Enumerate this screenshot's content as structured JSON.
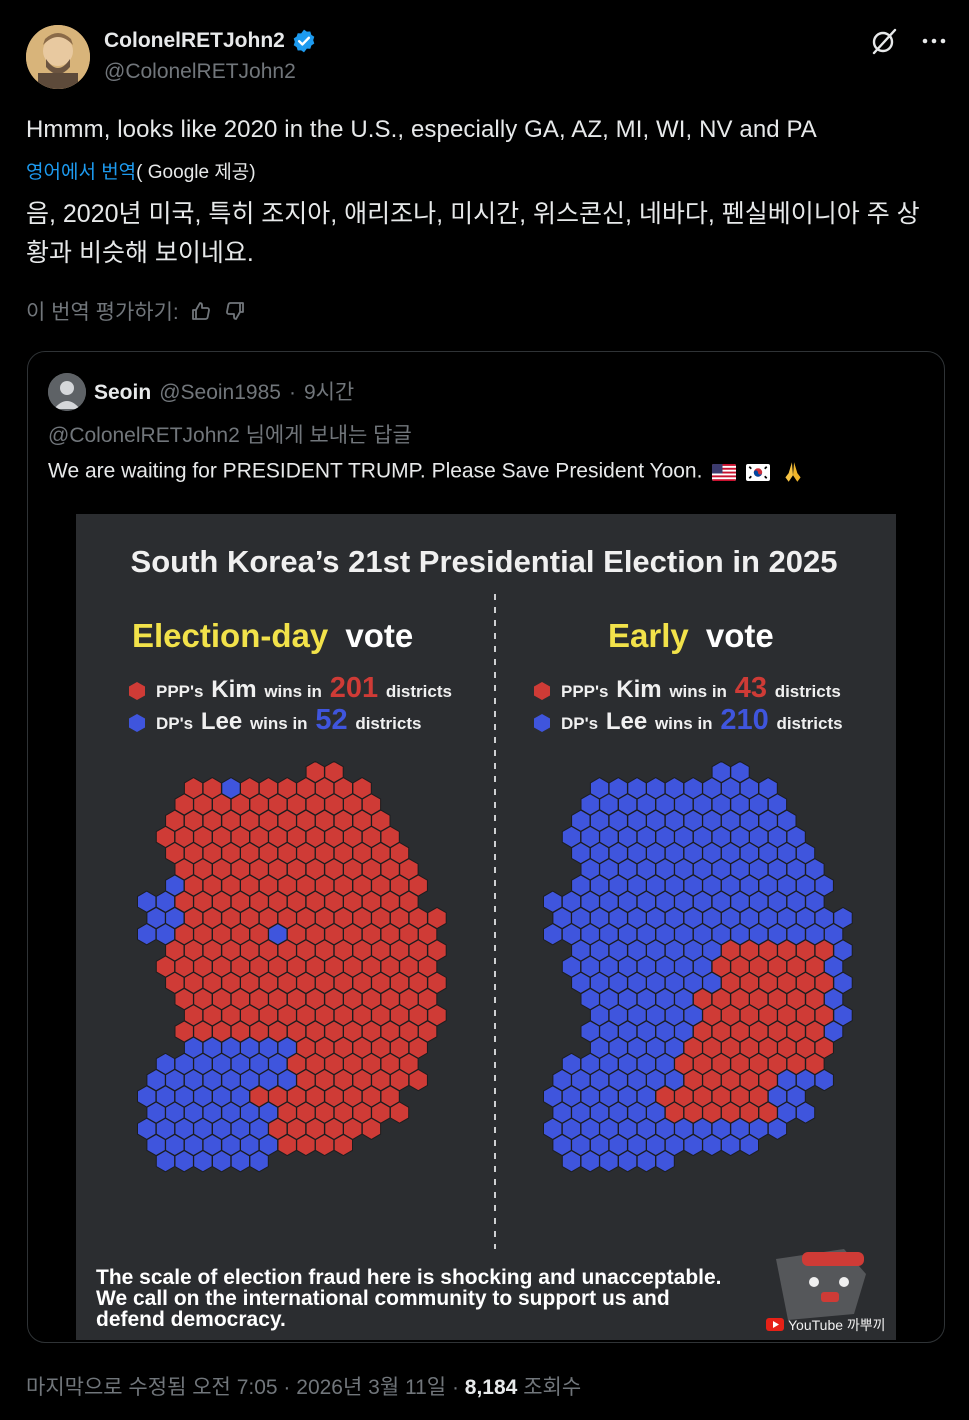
{
  "author": {
    "name": "ColonelRETJohn2",
    "handle": "@ColonelRETJohn2"
  },
  "icons": [
    "verified-badge-icon",
    "grok-slash-icon",
    "more-icon",
    "thumbs-up-icon",
    "thumbs-down-icon"
  ],
  "post": {
    "text": "Hmmm, looks like 2020 in the U.S., especially GA, AZ, MI, WI, NV and PA",
    "translate_link": "영어에서 번역",
    "translate_provider": "( Google 제공)",
    "translated_text": "음, 2020년 미국, 특히 조지아, 애리조나, 미시간, 위스콘신, 네바다, 펜실베이니아 주 상황과 비슷해 보이네요.",
    "rate_label": "이 번역 평가하기:"
  },
  "quote": {
    "name": "Seoin",
    "handle": "@Seoin1985",
    "dot": "·",
    "time": "9시간",
    "reply_to": "@ColonelRETJohn2 님에게 보내는 답글",
    "text": "We are waiting for PRESIDENT TRUMP. Please Save President Yoon."
  },
  "infographic": {
    "title": "South Korea’s 21st Presidential Election in 2025",
    "left": {
      "heading_a": "Election-day",
      "heading_b": "vote",
      "ppp_prefix": "PPP's",
      "ppp_name": "Kim",
      "wins_in": "wins in",
      "ppp_count": "201",
      "districts": "districts",
      "dp_prefix": "DP's",
      "dp_name": "Lee",
      "dp_count": "52"
    },
    "right": {
      "heading_a": "Early",
      "heading_b": "vote",
      "ppp_prefix": "PPP's",
      "ppp_name": "Kim",
      "wins_in": "wins in",
      "ppp_count": "43",
      "districts": "districts",
      "dp_prefix": "DP's",
      "dp_name": "Lee",
      "dp_count": "210"
    },
    "caption_1": "The scale of election fraud here is shocking and unacceptable.",
    "caption_2": "We call on the international community to support us and",
    "caption_3": "defend democracy.",
    "watermark": "YouTube 까뿌끼",
    "colors": {
      "red": "#cf3b36",
      "blue": "#3f55dd",
      "yellow": "#f2e24a",
      "bg": "#2b2d30"
    }
  },
  "footer": {
    "edited": "마지막으로 수정됨 오전 7:05",
    "dot1": "·",
    "date": "2026년 3월 11일",
    "dot2": "·",
    "views": "8,184",
    "views_label": "조회수"
  }
}
